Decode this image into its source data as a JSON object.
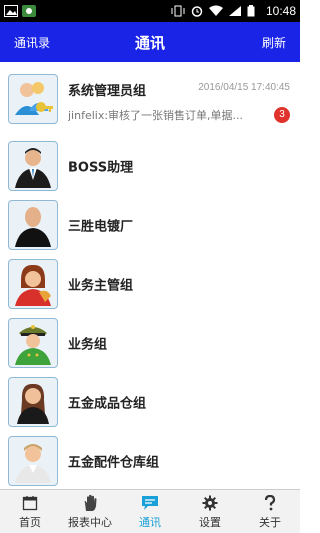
{
  "status_bar": {
    "time": "10:48"
  },
  "header": {
    "left": "通讯录",
    "title": "通讯",
    "right": "刷新"
  },
  "contacts": [
    {
      "name": "系统管理员组",
      "time": "2016/04/15 17:40:45",
      "message": "jinfelix:审核了一张销售订单,单据...",
      "badge": "3",
      "icon": "admin-users-icon"
    },
    {
      "name": "BOSS助理",
      "icon": "businessman-icon"
    },
    {
      "name": "三胜电镀厂",
      "icon": "bald-man-icon"
    },
    {
      "name": "业务主管组",
      "icon": "manager-woman-icon"
    },
    {
      "name": "业务组",
      "icon": "officer-icon"
    },
    {
      "name": "五金成品仓组",
      "icon": "woman-icon"
    },
    {
      "name": "五金配件仓库组",
      "icon": "man-icon"
    }
  ],
  "tabs": [
    {
      "label": "首页",
      "icon": "calendar-icon"
    },
    {
      "label": "报表中心",
      "icon": "hand-icon"
    },
    {
      "label": "通讯",
      "icon": "chat-icon",
      "active": true
    },
    {
      "label": "设置",
      "icon": "gear-icon"
    },
    {
      "label": "关于",
      "icon": "question-icon"
    }
  ],
  "colors": {
    "header": "#1a24e6",
    "active_tab": "#1aa0d8",
    "badge": "#e0332b"
  }
}
